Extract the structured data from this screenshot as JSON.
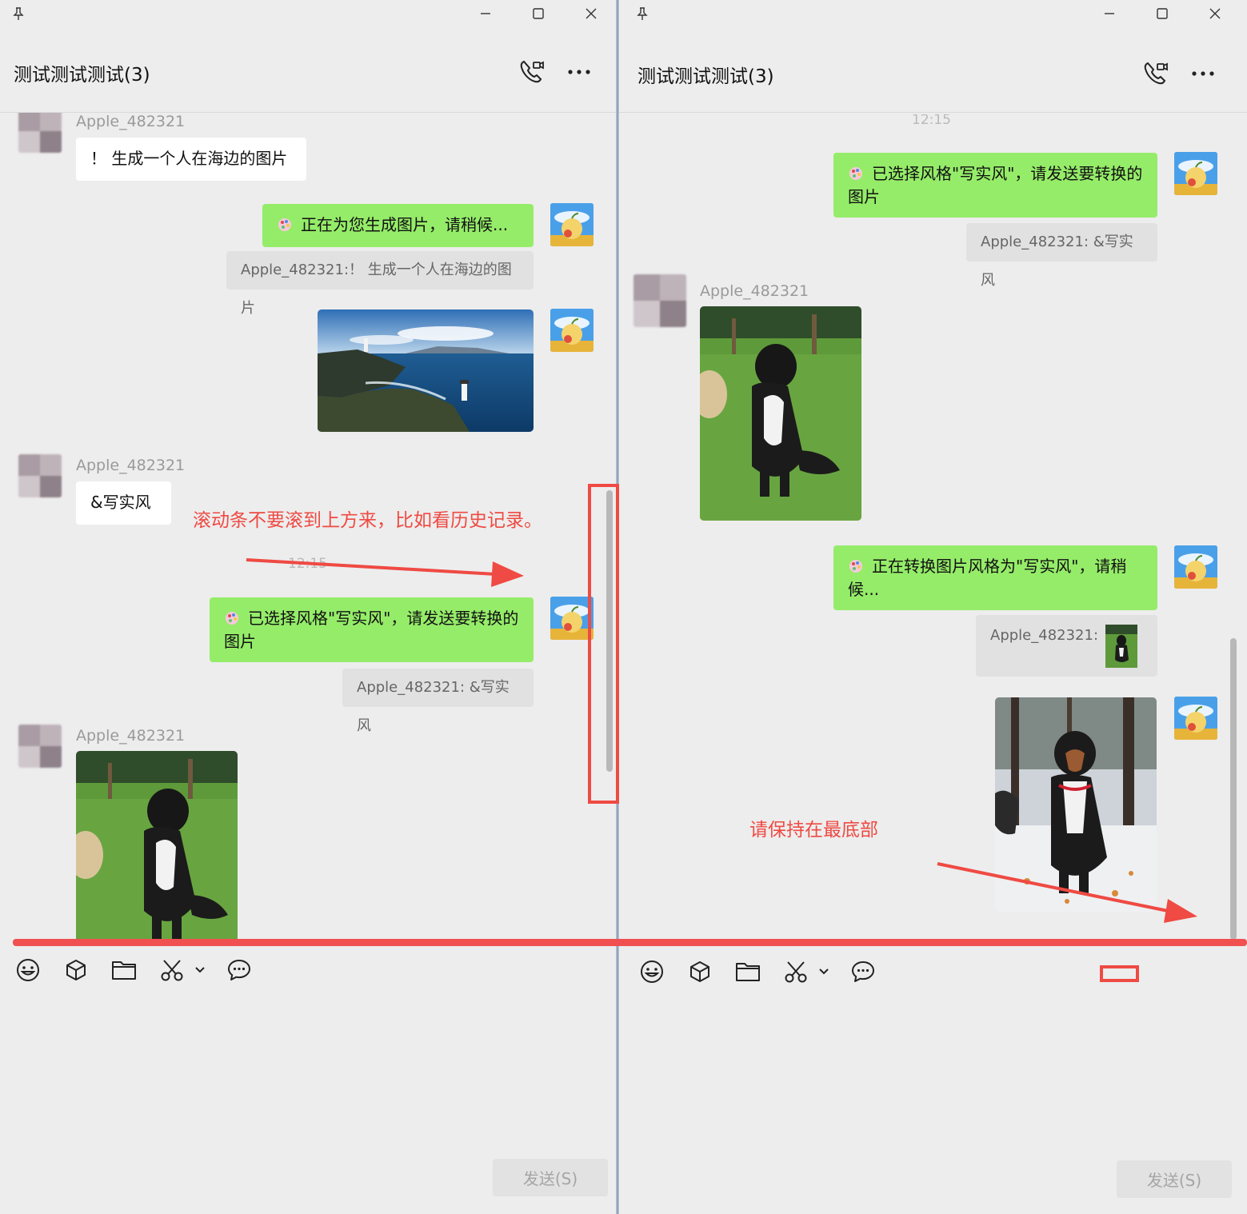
{
  "left": {
    "chat_title": "测试测试测试(3)",
    "messages": {
      "m1_sender": "Apple_482321",
      "m1_text": "！ 生成一个人在海边的图片",
      "m2_text": "正在为您生成图片，请稍候...",
      "m2_quote": "Apple_482321:！ 生成一个人在海边的图片",
      "m4_sender": "Apple_482321",
      "m4_text": "&写实风",
      "time": "12:15",
      "m5_text": "已选择风格\"写实风\"，请发送要转换的图片",
      "m5_quote": "Apple_482321: &写实风",
      "m6_sender": "Apple_482321"
    },
    "send_label": "发送(S)"
  },
  "right": {
    "chat_title": "测试测试测试(3)",
    "messages": {
      "time": "12:15",
      "m1_text": "已选择风格\"写实风\"，请发送要转换的图片",
      "m1_quote": "Apple_482321: &写实风",
      "m2_sender": "Apple_482321",
      "m3_text": "正在转换图片风格为\"写实风\"，请稍候...",
      "m3_quote": "Apple_482321:"
    },
    "send_label": "发送(S)"
  },
  "annotations": {
    "left_note": "滚动条不要滚到上方来，比如看历史记录。",
    "right_note": "请保持在最底部"
  },
  "colors": {
    "bubble_green": "#95ec69",
    "bubble_white": "#ffffff",
    "annotation_red": "#ef4a43"
  },
  "icons": [
    "pin-icon",
    "minimize-icon",
    "maximize-icon",
    "close-icon",
    "voice-video-call-icon",
    "more-icon",
    "emoji-icon",
    "cube-icon",
    "folder-icon",
    "scissors-icon",
    "chevron-down-icon",
    "chat-bubble-icon",
    "palette-icon"
  ]
}
